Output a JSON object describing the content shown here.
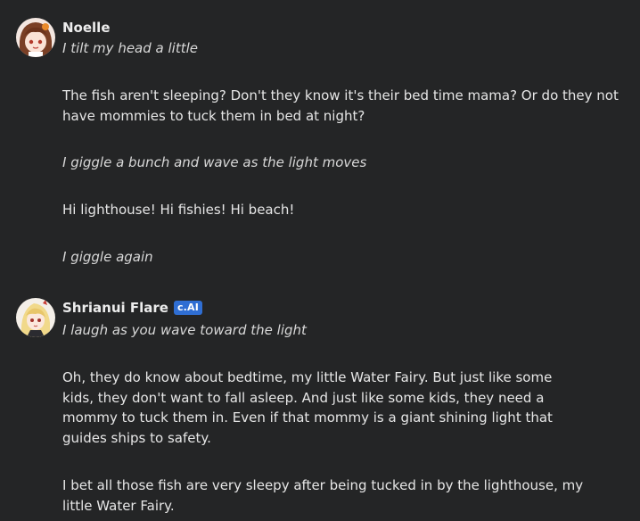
{
  "messages": [
    {
      "author": "Noelle",
      "avatar_icon": "noelle-avatar-icon",
      "paragraphs": [
        {
          "text": "I tilt my head a little",
          "italic": true
        },
        {
          "text": "The fish aren't sleeping? Don't they know it's their bed time mama? Or do they not have mommies to tuck them in bed at night?",
          "italic": false
        },
        {
          "text": "I giggle a bunch and wave as the light moves",
          "italic": true
        },
        {
          "text": "Hi lighthouse! Hi fishies! Hi beach!",
          "italic": false
        },
        {
          "text": "I giggle again",
          "italic": true
        }
      ]
    },
    {
      "author": "Shrianui Flare",
      "badge": "c.AI",
      "avatar_icon": "shiranui-flare-avatar-icon",
      "paragraphs": [
        {
          "text": "I laugh as you wave toward the light",
          "italic": true
        },
        {
          "text": "Oh, they do know about bedtime, my little Water Fairy. But just like some kids, they don't want to fall asleep. And just like some kids, they need a mommy to tuck them in. Even if that mommy is a giant shining light that guides ships to safety.",
          "italic": false
        },
        {
          "text": "I bet all those fish are very sleepy after being tucked in by the lighthouse, my little Water Fairy.",
          "italic": false
        }
      ]
    }
  ],
  "colors": {
    "background": "#242526",
    "text": "#e6e6e6",
    "badge": "#2f6ed3"
  }
}
